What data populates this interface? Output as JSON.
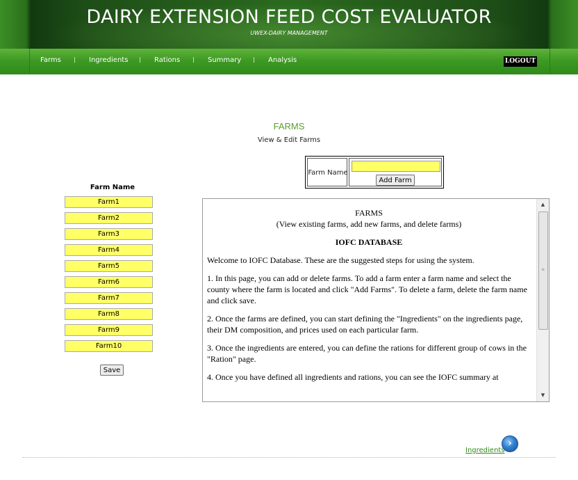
{
  "header": {
    "title": "DAIRY EXTENSION FEED COST EVALUATOR",
    "subtitle": "UWEX-DAIRY MANAGEMENT"
  },
  "nav": {
    "items": [
      "Farms",
      "Ingredients",
      "Rations",
      "Summary",
      "Analysis"
    ],
    "logout": "LOGOUT"
  },
  "page": {
    "title": "FARMS",
    "subtitle": "View & Edit Farms"
  },
  "add_farm": {
    "label": "Farm Name",
    "value": "",
    "button": "Add Farm"
  },
  "farm_list": {
    "header": "Farm Name",
    "farms": [
      "Farm1",
      "Farm2",
      "Farm3",
      "Farm4",
      "Farm5",
      "Farm6",
      "Farm7",
      "Farm8",
      "Farm9",
      "Farm10"
    ],
    "save": "Save"
  },
  "info": {
    "heading": "FARMS",
    "subheading": "(View existing farms, add new farms, and delete farms)",
    "db_title": "IOFC DATABASE",
    "paragraphs": [
      "Welcome to IOFC Database. These are the suggested steps for using the system.",
      "1. In this page, you can add or delete farms. To add a farm enter a farm name and select the county where the farm is located and click \"Add Farms\". To delete a farm, delete the farm name and click save.",
      "2. Once the farms are defined, you can start defining the \"Ingredients\" on the ingredients page, their DM composition, and prices used on each particular farm.",
      "3. Once the ingredients are entered, you can define the rations for different group of cows in the \"Ration\" page.",
      "4. Once you have defined all ingredients and rations, you can see the IOFC summary at"
    ]
  },
  "footer": {
    "next_link": "Ingredients"
  },
  "colors": {
    "header_dark": "#1e4d17",
    "nav_green": "#3e9a24",
    "field_yellow": "#ffff66",
    "title_green": "#5a9e2a",
    "link_green": "#2e8b1a"
  }
}
